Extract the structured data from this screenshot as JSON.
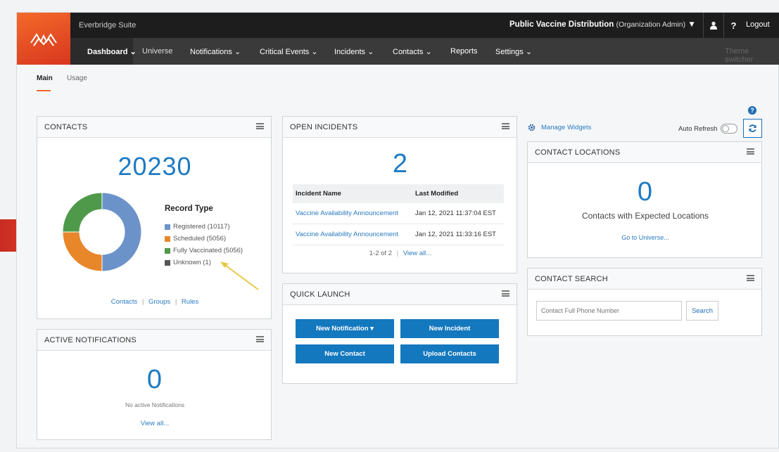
{
  "header": {
    "suite_name": "Everbridge Suite",
    "org_name": "Public Vaccine Distribution",
    "org_role": "(Organization Admin)",
    "logout": "Logout",
    "theme_switcher": "Theme switcher"
  },
  "nav": {
    "dashboard": "Dashboard",
    "universe": "Universe",
    "notifications": "Notifications",
    "critical_events": "Critical Events",
    "incidents": "Incidents",
    "contacts": "Contacts",
    "reports": "Reports",
    "settings": "Settings"
  },
  "tabs": {
    "main": "Main",
    "usage": "Usage"
  },
  "contacts_panel": {
    "title": "CONTACTS",
    "total": "20230",
    "legend_title": "Record Type",
    "legend": [
      {
        "label": "Registered (10117)",
        "color": "#6b93c9"
      },
      {
        "label": "Scheduled (5056)",
        "color": "#e8862a"
      },
      {
        "label": "Fully Vaccinated (5056)",
        "color": "#4f9a4a"
      },
      {
        "label": "Unknown (1)",
        "color": "#555555"
      }
    ],
    "links": {
      "contacts": "Contacts",
      "groups": "Groups",
      "rules": "Rules"
    },
    "sep": "|"
  },
  "chart_data": {
    "type": "pie",
    "categories": [
      "Registered",
      "Scheduled",
      "Fully Vaccinated",
      "Unknown"
    ],
    "values": [
      10117,
      5056,
      5056,
      1
    ],
    "colors": [
      "#6b93c9",
      "#e8862a",
      "#4f9a4a",
      "#555555"
    ],
    "title": "Record Type"
  },
  "active_notifications": {
    "title": "ACTIVE NOTIFICATIONS",
    "count": "0",
    "empty_text": "No active Notifications",
    "view_all": "View all..."
  },
  "open_incidents": {
    "title": "OPEN INCIDENTS",
    "count": "2",
    "columns": [
      "Incident Name",
      "Last Modified"
    ],
    "rows": [
      {
        "name": "Vaccine Availability Announcement",
        "modified": "Jan 12, 2021 11:37:04 EST"
      },
      {
        "name": "Vaccine Availability Announcement",
        "modified": "Jan 12, 2021 11:33:16 EST"
      }
    ],
    "pager": "1-2 of 2",
    "sep": "|",
    "view_all": "View all..."
  },
  "quick_launch": {
    "title": "QUICK LAUNCH",
    "new_notification": "New Notification ▾",
    "new_incident": "New Incident",
    "new_contact": "New Contact",
    "upload_contacts": "Upload Contacts"
  },
  "right_col": {
    "manage_widgets": "Manage Widgets",
    "auto_refresh": "Auto Refresh"
  },
  "contact_locations": {
    "title": "CONTACT LOCATIONS",
    "count": "0",
    "subtitle": "Contacts with Expected Locations",
    "link": "Go to Universe..."
  },
  "contact_search": {
    "title": "CONTACT SEARCH",
    "placeholder": "Contact Full Phone Number",
    "button": "Search"
  }
}
